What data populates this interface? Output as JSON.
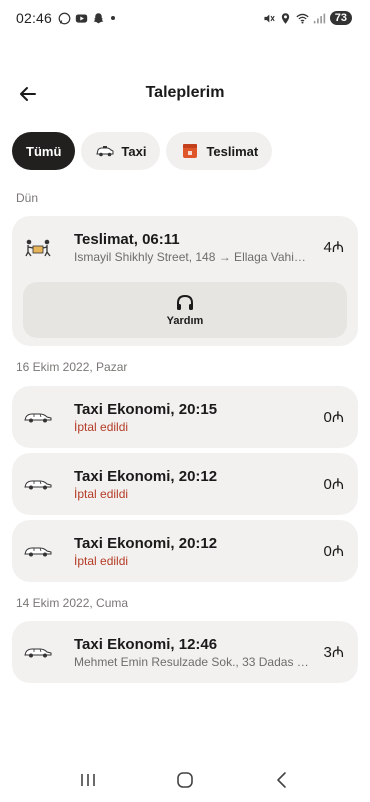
{
  "status_bar": {
    "time": "02:46",
    "battery": "73",
    "notification_icons": [
      "whatsapp-icon",
      "youtube-icon",
      "snapchat-icon"
    ],
    "system_icons": [
      "mute-icon",
      "location-icon",
      "wifi-icon",
      "signal-icon"
    ]
  },
  "header": {
    "title": "Taleplerim",
    "back_icon": "arrow-left-icon"
  },
  "filters": [
    {
      "label": "Tümü",
      "active": true
    },
    {
      "label": "Taxi",
      "active": false,
      "icon": "taxi-car-icon"
    },
    {
      "label": "Teslimat",
      "active": false,
      "icon": "delivery-box-icon"
    }
  ],
  "sections": [
    {
      "label": "Dün",
      "orders": [
        {
          "title": "Teslimat, 06:11",
          "subtitle": "Ismayil Shikhly Street, 148 → Ellaga Vahi…",
          "price": "4₼",
          "icon": "delivery-courier-icon",
          "help_label": "Yardım"
        }
      ]
    },
    {
      "label": "16 Ekim 2022, Pazar",
      "orders": [
        {
          "title": "Taxi Ekonomi, 20:15",
          "subtitle": "İptal edildi",
          "price": "0₼",
          "icon": "car-icon",
          "cancelled": true
        },
        {
          "title": "Taxi Ekonomi, 20:12",
          "subtitle": "İptal edildi",
          "price": "0₼",
          "icon": "car-icon",
          "cancelled": true
        },
        {
          "title": "Taxi Ekonomi, 20:12",
          "subtitle": "İptal edildi",
          "price": "0₼",
          "icon": "car-icon",
          "cancelled": true
        }
      ]
    },
    {
      "label": "14 Ekim 2022, Cuma",
      "orders": [
        {
          "title": "Taxi Ekonomi, 12:46",
          "subtitle": "Mehmet Emin Resulzade Sok., 33 Dadas …",
          "price": "3₼",
          "icon": "car-icon"
        }
      ]
    }
  ],
  "colors": {
    "active_chip": "#21201f",
    "card_bg": "#f2f1ef",
    "cancel_text": "#b43b26",
    "delivery_badge": "#e0562b"
  },
  "navigation": [
    "recent-apps-icon",
    "home-icon",
    "back-icon"
  ]
}
